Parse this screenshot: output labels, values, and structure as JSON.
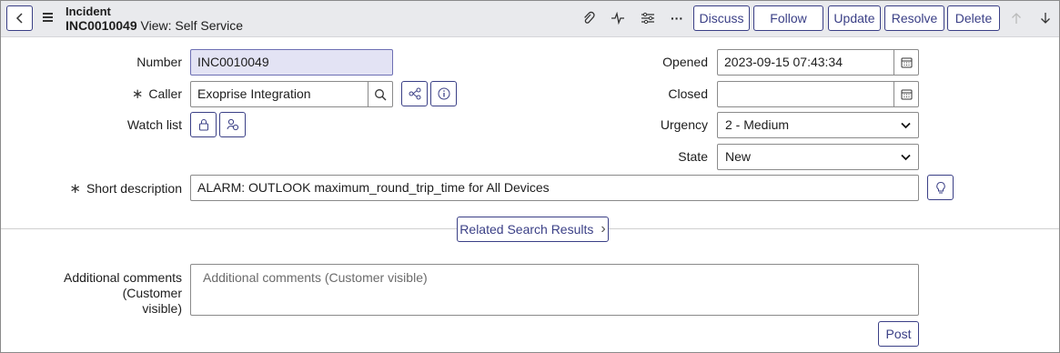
{
  "header": {
    "record_type": "Incident",
    "record_number": "INC0010049",
    "view_label": "View: Self Service",
    "buttons": {
      "discuss": "Discuss",
      "follow": "Follow",
      "update": "Update",
      "resolve": "Resolve",
      "delete": "Delete"
    },
    "more_label": "···"
  },
  "form": {
    "number": {
      "label": "Number",
      "value": "INC0010049"
    },
    "caller": {
      "label": "Caller",
      "value": "Exoprise Integration",
      "required_mark": "∗"
    },
    "watch_list": {
      "label": "Watch list"
    },
    "opened": {
      "label": "Opened",
      "value": "2023-09-15 07:43:34"
    },
    "closed": {
      "label": "Closed",
      "value": ""
    },
    "urgency": {
      "label": "Urgency",
      "value": "2 - Medium"
    },
    "state": {
      "label": "State",
      "value": "New"
    },
    "short_description": {
      "label": "Short description",
      "value": "ALARM: OUTLOOK maximum_round_trip_time for All Devices",
      "required_mark": "∗"
    }
  },
  "related_search": {
    "label": "Related Search Results",
    "chevron": "›"
  },
  "comments": {
    "label_line1": "Additional comments (Customer",
    "label_line2": "visible)",
    "placeholder": "Additional comments (Customer visible)",
    "post_label": "Post"
  },
  "colors": {
    "accent": "#3a3f86",
    "header_bg": "#e9eaed",
    "readonly_bg": "#e3e3f4"
  }
}
